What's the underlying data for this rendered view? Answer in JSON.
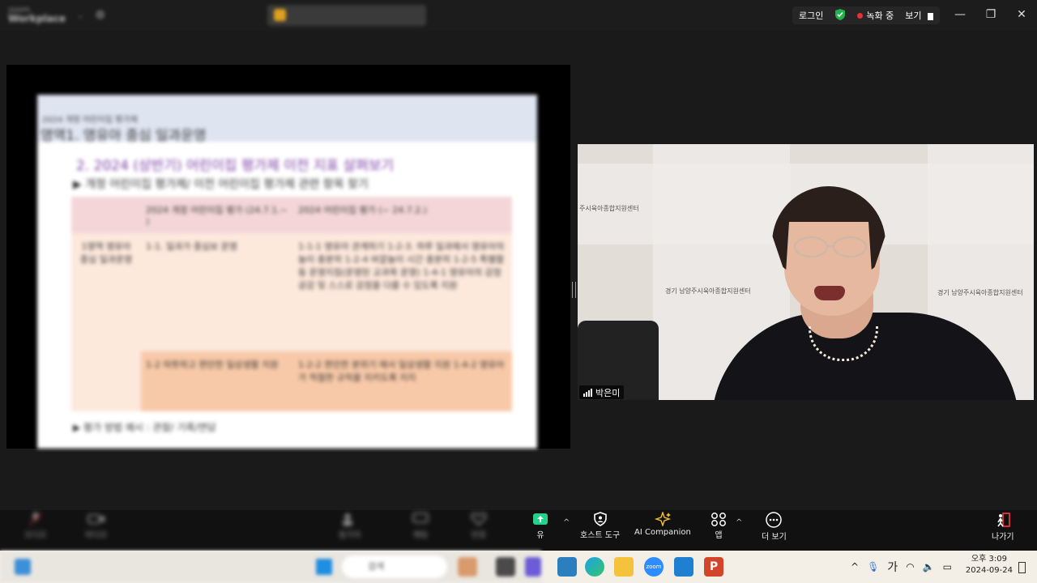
{
  "titlebar": {
    "app_name_top": "zoom",
    "app_name": "Workplace",
    "login": "로그인",
    "recording": "녹화 중",
    "view": "보기",
    "win_minimize": "—",
    "win_restore": "❐",
    "win_close": "✕"
  },
  "slide": {
    "small_header": "2024 개정 어린이집 평가제",
    "header": "영역1. 영유아 중심 일과운영",
    "heading": "2. 2024 (상반기) 어린이집 평가제 이전 지표 살펴보기",
    "subheading": "▶ 개정 어린이집 평가제/ 이전 어린이집 평가제 관련 항목 찾기",
    "col1": "2024 개정 어린이집 평가 (24.7.1.~ )",
    "col2": "2024 어린이집 평가 (~ 24.7.2.)",
    "row_label": "1영역 영유아 중심 일과운영",
    "r1a": "1-1. 일과가 중심보 운영",
    "r1b": "1-1-1 영유아 관계하기 1-2-3. 하루 일과에서 영유아의 놀이 충분히 1-2-4 바깥놀이 시간 충분히 1-2-5 특별활동 운영지침(운영된 교과목 운영) 1-4-1 영유아의 감정 공감 및 스스로 감정을 다룰 수 있도록 지원",
    "r2a": "1-2 따뜻하고 편안한 일상생활 지원",
    "r2b": "1-2-2 편안한 분위기 에서 일상생활 지원 1-4-2 영유아가 적절한 규칙을 지키도록 지지",
    "footer": "▶ 평가 방법 예시 : 관찰/ 기록/면담"
  },
  "video": {
    "participant_name": "박은미",
    "banner_text": "경기 남양주시육아종합지원센터",
    "banner_text_short": "주시육아종합지원센터"
  },
  "toolbar": {
    "share_label": "유",
    "host_tools": "호스트 도구",
    "ai_companion": "AI Companion",
    "apps": "앱",
    "more": "더 보기",
    "leave": "나가기",
    "blur_audio": "오디오",
    "blur_video": "비디오",
    "blur_participants": "참가자",
    "blur_chat": "채팅",
    "blur_react": "반응"
  },
  "taskbar": {
    "search_placeholder": "검색",
    "ime": "가",
    "time": "오후 3:09",
    "date": "2024-09-24"
  },
  "colors": {
    "recording_dot": "#e3323b",
    "security_green": "#22b14c",
    "share_green": "#23d18b",
    "leave_red": "#e3323b"
  }
}
